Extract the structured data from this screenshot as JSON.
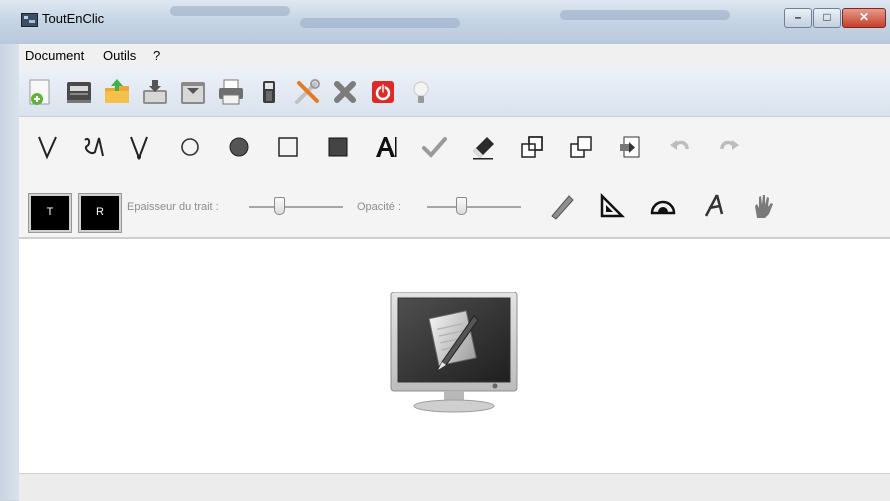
{
  "window": {
    "title": "ToutEnClic"
  },
  "menu": {
    "items": [
      "Document",
      "Outils",
      "?"
    ]
  },
  "controls": {
    "btn_t": "T",
    "btn_r": "R",
    "thickness_label": "Epaisseur du trait :",
    "opacity_label": "Opacité :",
    "thickness_value": 0.3,
    "opacity_value": 0.35
  },
  "icons": {
    "toolbar1": [
      "new-document-icon",
      "scanner-icon",
      "open-folder-icon",
      "save-icon",
      "save-as-icon",
      "print-icon",
      "usb-drive-icon",
      "settings-tools-icon",
      "delete-icon",
      "power-icon",
      "lightbulb-icon"
    ],
    "toolbar2": [
      "pen-icon",
      "freehand-pen-icon",
      "pencil-icon",
      "circle-outline-icon",
      "circle-filled-icon",
      "square-outline-icon",
      "square-filled-icon",
      "text-icon",
      "check-icon",
      "eraser-icon",
      "copy-icon",
      "paste-icon",
      "import-icon",
      "undo-icon",
      "redo-icon"
    ],
    "toolbar3": [
      "ruler-icon",
      "set-square-icon",
      "protractor-icon",
      "compass-icon",
      "hand-icon"
    ]
  },
  "colors": {
    "accent": "#c5402a",
    "title_gradient": "#c6d5e5"
  }
}
